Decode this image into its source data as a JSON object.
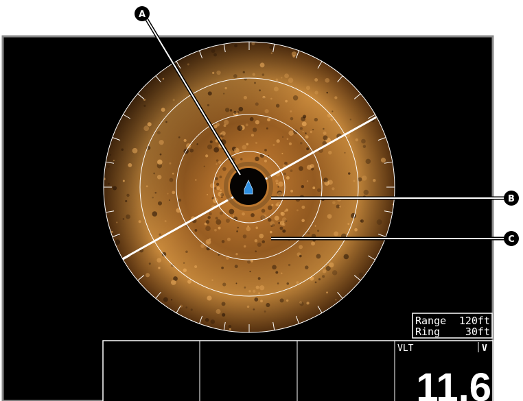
{
  "callouts": {
    "a": "A",
    "b": "B",
    "c": "C"
  },
  "info_box": {
    "range_label": "Range",
    "range_value": "120ft",
    "ring_label": "Ring",
    "ring_value": "30ft"
  },
  "data_bar": {
    "vlt_label": "VLT",
    "unit": "V",
    "value": "11.6"
  },
  "colors": {
    "background": "#000000",
    "frame": "#8a8a8a",
    "sonar_warm": "#c98a3c",
    "sonar_dark": "#2a1606",
    "boat_icon": "#2f8fe0"
  },
  "icons": {
    "boat": "boat-icon"
  }
}
